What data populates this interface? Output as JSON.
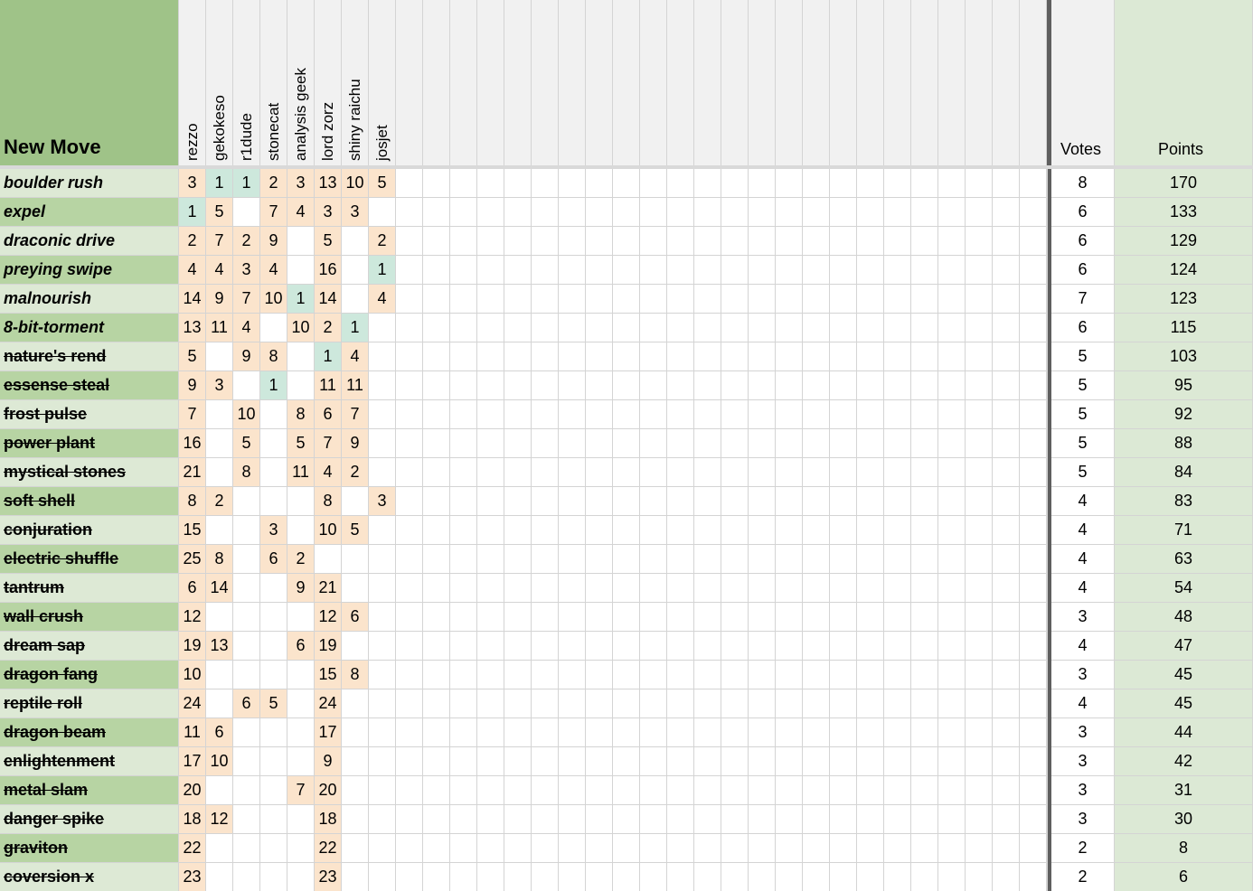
{
  "header": {
    "move_col_label": "New Move",
    "voters": [
      "rezzo",
      "gekokeso",
      "r1dude",
      "stonecat",
      "analysis geek",
      "lord zorz",
      "shiny raichu",
      "josjet"
    ],
    "votes_label": "Votes",
    "points_label": "Points"
  },
  "colors": {
    "header_green": "#9fc388",
    "row_light_green": "#dde9d5",
    "row_dark_green": "#b7d4a3",
    "peach": "#fbe4cc",
    "teal": "#cde8dc",
    "header_gray": "#f1f1f1",
    "stripe_gray": "#f3f3f3",
    "points_green": "#dce9d5"
  },
  "rows": [
    {
      "move": "boulder rush",
      "style": "italic",
      "ranks": [
        "3",
        "1",
        "1",
        "2",
        "3",
        "13",
        "10",
        "5"
      ],
      "fills": [
        "p",
        "t",
        "t",
        "p",
        "p",
        "p",
        "p",
        "p"
      ],
      "votes": "8",
      "points": "170"
    },
    {
      "move": "expel",
      "style": "italic",
      "ranks": [
        "1",
        "5",
        "",
        "7",
        "4",
        "3",
        "3",
        ""
      ],
      "fills": [
        "t",
        "p",
        "",
        "p",
        "p",
        "p",
        "p",
        ""
      ],
      "votes": "6",
      "points": "133"
    },
    {
      "move": "draconic drive",
      "style": "italic",
      "ranks": [
        "2",
        "7",
        "2",
        "9",
        "",
        "5",
        "",
        "2"
      ],
      "fills": [
        "p",
        "p",
        "p",
        "p",
        "",
        "p",
        "",
        "p"
      ],
      "votes": "6",
      "points": "129"
    },
    {
      "move": "preying swipe",
      "style": "italic",
      "ranks": [
        "4",
        "4",
        "3",
        "4",
        "",
        "16",
        "",
        "1"
      ],
      "fills": [
        "p",
        "p",
        "p",
        "p",
        "",
        "p",
        "",
        "t"
      ],
      "votes": "6",
      "points": "124"
    },
    {
      "move": "malnourish",
      "style": "italic",
      "ranks": [
        "14",
        "9",
        "7",
        "10",
        "1",
        "14",
        "",
        "4"
      ],
      "fills": [
        "p",
        "p",
        "p",
        "p",
        "t",
        "p",
        "",
        "p"
      ],
      "votes": "7",
      "points": "123"
    },
    {
      "move": "8-bit-torment",
      "style": "italic",
      "ranks": [
        "13",
        "11",
        "4",
        "",
        "10",
        "2",
        "1",
        ""
      ],
      "fills": [
        "p",
        "p",
        "p",
        "",
        "p",
        "p",
        "t",
        ""
      ],
      "votes": "6",
      "points": "115"
    },
    {
      "move": "nature's rend",
      "style": "strike",
      "ranks": [
        "5",
        "",
        "9",
        "8",
        "",
        "1",
        "4",
        ""
      ],
      "fills": [
        "p",
        "",
        "p",
        "p",
        "",
        "t",
        "p",
        ""
      ],
      "votes": "5",
      "points": "103"
    },
    {
      "move": "essense steal",
      "style": "strike",
      "ranks": [
        "9",
        "3",
        "",
        "1",
        "",
        "11",
        "11",
        ""
      ],
      "fills": [
        "p",
        "p",
        "",
        "t",
        "",
        "p",
        "p",
        ""
      ],
      "votes": "5",
      "points": "95"
    },
    {
      "move": "frost pulse",
      "style": "strike",
      "ranks": [
        "7",
        "",
        "10",
        "",
        "8",
        "6",
        "7",
        ""
      ],
      "fills": [
        "p",
        "",
        "p",
        "",
        "p",
        "p",
        "p",
        ""
      ],
      "votes": "5",
      "points": "92"
    },
    {
      "move": "power plant",
      "style": "strike",
      "ranks": [
        "16",
        "",
        "5",
        "",
        "5",
        "7",
        "9",
        ""
      ],
      "fills": [
        "p",
        "",
        "p",
        "",
        "p",
        "p",
        "p",
        ""
      ],
      "votes": "5",
      "points": "88"
    },
    {
      "move": "mystical stones",
      "style": "strike",
      "ranks": [
        "21",
        "",
        "8",
        "",
        "11",
        "4",
        "2",
        ""
      ],
      "fills": [
        "p",
        "",
        "p",
        "",
        "p",
        "p",
        "p",
        ""
      ],
      "votes": "5",
      "points": "84"
    },
    {
      "move": "soft shell",
      "style": "strike",
      "ranks": [
        "8",
        "2",
        "",
        "",
        "",
        "8",
        "",
        "3"
      ],
      "fills": [
        "p",
        "p",
        "",
        "",
        "",
        "p",
        "",
        "p"
      ],
      "votes": "4",
      "points": "83"
    },
    {
      "move": "conjuration",
      "style": "strike",
      "ranks": [
        "15",
        "",
        "",
        "3",
        "",
        "10",
        "5",
        ""
      ],
      "fills": [
        "p",
        "",
        "",
        "p",
        "",
        "p",
        "p",
        ""
      ],
      "votes": "4",
      "points": "71"
    },
    {
      "move": "electric shuffle",
      "style": "strike",
      "ranks": [
        "25",
        "8",
        "",
        "6",
        "2",
        "",
        "",
        ""
      ],
      "fills": [
        "p",
        "p",
        "",
        "p",
        "p",
        "",
        "",
        ""
      ],
      "votes": "4",
      "points": "63"
    },
    {
      "move": "tantrum",
      "style": "strike",
      "ranks": [
        "6",
        "14",
        "",
        "",
        "9",
        "21",
        "",
        ""
      ],
      "fills": [
        "p",
        "p",
        "",
        "",
        "p",
        "p",
        "",
        ""
      ],
      "votes": "4",
      "points": "54"
    },
    {
      "move": "wall crush",
      "style": "strike",
      "ranks": [
        "12",
        "",
        "",
        "",
        "",
        "12",
        "6",
        ""
      ],
      "fills": [
        "p",
        "",
        "",
        "",
        "",
        "p",
        "p",
        ""
      ],
      "votes": "3",
      "points": "48"
    },
    {
      "move": "dream sap",
      "style": "strike",
      "ranks": [
        "19",
        "13",
        "",
        "",
        "6",
        "19",
        "",
        ""
      ],
      "fills": [
        "p",
        "p",
        "",
        "",
        "p",
        "p",
        "",
        ""
      ],
      "votes": "4",
      "points": "47"
    },
    {
      "move": "dragon fang",
      "style": "strike",
      "ranks": [
        "10",
        "",
        "",
        "",
        "",
        "15",
        "8",
        ""
      ],
      "fills": [
        "p",
        "",
        "",
        "",
        "",
        "p",
        "p",
        ""
      ],
      "votes": "3",
      "points": "45"
    },
    {
      "move": "reptile roll",
      "style": "strike",
      "ranks": [
        "24",
        "",
        "6",
        "5",
        "",
        "24",
        "",
        ""
      ],
      "fills": [
        "p",
        "",
        "p",
        "p",
        "",
        "p",
        "",
        ""
      ],
      "votes": "4",
      "points": "45"
    },
    {
      "move": "dragon beam",
      "style": "strike",
      "ranks": [
        "11",
        "6",
        "",
        "",
        "",
        "17",
        "",
        ""
      ],
      "fills": [
        "p",
        "p",
        "",
        "",
        "",
        "p",
        "",
        ""
      ],
      "votes": "3",
      "points": "44"
    },
    {
      "move": "enlightenment",
      "style": "strike",
      "ranks": [
        "17",
        "10",
        "",
        "",
        "",
        "9",
        "",
        ""
      ],
      "fills": [
        "p",
        "p",
        "",
        "",
        "",
        "p",
        "",
        ""
      ],
      "votes": "3",
      "points": "42"
    },
    {
      "move": "metal slam",
      "style": "strike",
      "ranks": [
        "20",
        "",
        "",
        "",
        "7",
        "20",
        "",
        ""
      ],
      "fills": [
        "p",
        "",
        "",
        "",
        "p",
        "p",
        "",
        ""
      ],
      "votes": "3",
      "points": "31"
    },
    {
      "move": "danger spike",
      "style": "strike",
      "ranks": [
        "18",
        "12",
        "",
        "",
        "",
        "18",
        "",
        ""
      ],
      "fills": [
        "p",
        "p",
        "",
        "",
        "",
        "p",
        "",
        ""
      ],
      "votes": "3",
      "points": "30"
    },
    {
      "move": "graviton",
      "style": "strike",
      "ranks": [
        "22",
        "",
        "",
        "",
        "",
        "22",
        "",
        ""
      ],
      "fills": [
        "p",
        "",
        "",
        "",
        "",
        "p",
        "",
        ""
      ],
      "votes": "2",
      "points": "8"
    },
    {
      "move": "coversion x",
      "style": "strike",
      "ranks": [
        "23",
        "",
        "",
        "",
        "",
        "23",
        "",
        ""
      ],
      "fills": [
        "p",
        "",
        "",
        "",
        "",
        "p",
        "",
        ""
      ],
      "votes": "2",
      "points": "6"
    }
  ]
}
